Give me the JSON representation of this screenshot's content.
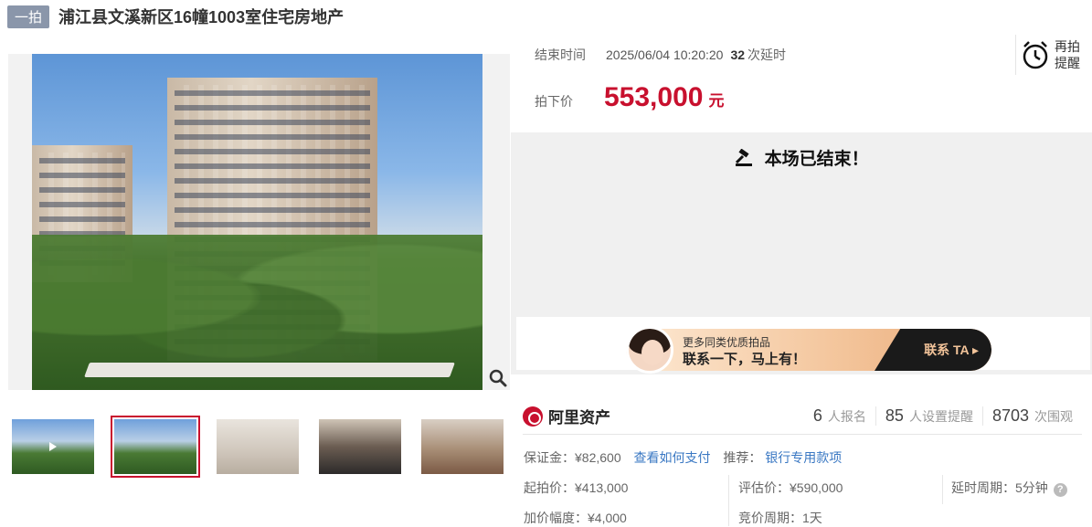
{
  "header": {
    "badge": "一拍",
    "title": "浦江县文溪新区16幢1003室住宅房地产"
  },
  "auction": {
    "end_label": "结束时间",
    "end_time": "2025/06/04 10:20:20",
    "delay_count": "32",
    "delay_label": "次延时",
    "price_label": "拍下价",
    "price": "553,000",
    "price_unit": "元",
    "reminder_line1": "再拍",
    "reminder_line2": "提醒",
    "ended_text": "本场已结束！"
  },
  "banner": {
    "line1": "更多同类优质拍品",
    "line2": "联系一下，马上有！",
    "cta": "联系 TA ▸"
  },
  "stats": {
    "brand": "阿里资产",
    "signup_num": "6",
    "signup_label": "人报名",
    "remind_num": "85",
    "remind_label": "人设置提醒",
    "view_num": "8703",
    "view_label": "次围观"
  },
  "details": {
    "deposit": "保证金：¥82,600",
    "pay_link": "查看如何支付",
    "recommend_label": "推荐：",
    "recommend_link": "银行专用款项",
    "start_price": "起拍价：¥413,000",
    "appraisal": "评估价：¥590,000",
    "delay_period": "延时周期：5分钟",
    "increment": "加价幅度：¥4,000",
    "bid_period": "竞价周期：1天"
  },
  "thumbnails": [
    "exterior-video",
    "exterior-photo",
    "living-room",
    "kitchen",
    "bedroom"
  ]
}
